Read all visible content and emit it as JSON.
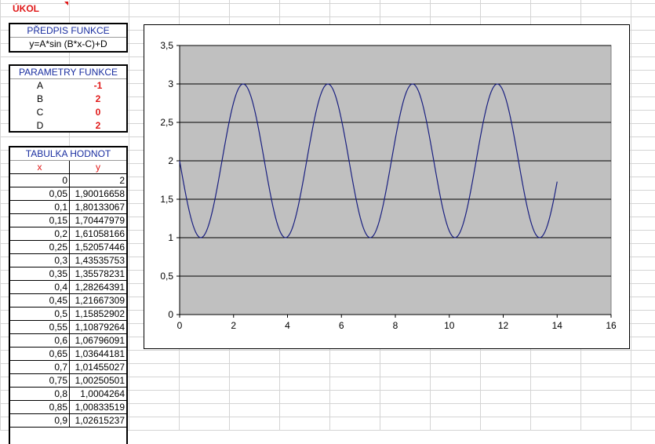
{
  "sheet": {
    "title": "ÚKOL"
  },
  "predpis": {
    "header": "PŘEDPIS FUNKCE",
    "formula": "y=A*sin (B*x-C)+D"
  },
  "parametry": {
    "header": "PARAMETRY FUNKCE",
    "params": [
      {
        "name": "A",
        "value": "-1"
      },
      {
        "name": "B",
        "value": "2"
      },
      {
        "name": "C",
        "value": "0"
      },
      {
        "name": "D",
        "value": "2"
      }
    ]
  },
  "tabulka": {
    "header": "TABULKA HODNOT",
    "col_x": "x",
    "col_y": "y",
    "rows": [
      {
        "x": "0",
        "y": "2"
      },
      {
        "x": "0,05",
        "y": "1,90016658"
      },
      {
        "x": "0,1",
        "y": "1,80133067"
      },
      {
        "x": "0,15",
        "y": "1,70447979"
      },
      {
        "x": "0,2",
        "y": "1,61058166"
      },
      {
        "x": "0,25",
        "y": "1,52057446"
      },
      {
        "x": "0,3",
        "y": "1,43535753"
      },
      {
        "x": "0,35",
        "y": "1,35578231"
      },
      {
        "x": "0,4",
        "y": "1,28264391"
      },
      {
        "x": "0,45",
        "y": "1,21667309"
      },
      {
        "x": "0,5",
        "y": "1,15852902"
      },
      {
        "x": "0,55",
        "y": "1,10879264"
      },
      {
        "x": "0,6",
        "y": "1,06796091"
      },
      {
        "x": "0,65",
        "y": "1,03644181"
      },
      {
        "x": "0,7",
        "y": "1,01455027"
      },
      {
        "x": "0,75",
        "y": "1,00250501"
      },
      {
        "x": "0,8",
        "y": "1,0004264"
      },
      {
        "x": "0,85",
        "y": "1,00833519"
      },
      {
        "x": "0,9",
        "y": "1,02615237"
      }
    ]
  },
  "chart_data": {
    "type": "line",
    "title": "",
    "xlabel": "",
    "ylabel": "",
    "xlim": [
      0,
      16
    ],
    "ylim": [
      0,
      3.5
    ],
    "x_ticks": [
      "0",
      "2",
      "4",
      "6",
      "8",
      "10",
      "12",
      "14",
      "16"
    ],
    "y_ticks": [
      "0",
      "0,5",
      "1",
      "1,5",
      "2",
      "2,5",
      "3",
      "3,5"
    ],
    "grid": "horizontal",
    "legend": "none",
    "plot_background": "#c0c0c0",
    "line_color": "#1a2080",
    "series": [
      {
        "x_start": 0,
        "x_end": 14,
        "x_step": 0.05,
        "A": -1,
        "B": 2,
        "C": 0,
        "D": 2
      }
    ]
  }
}
